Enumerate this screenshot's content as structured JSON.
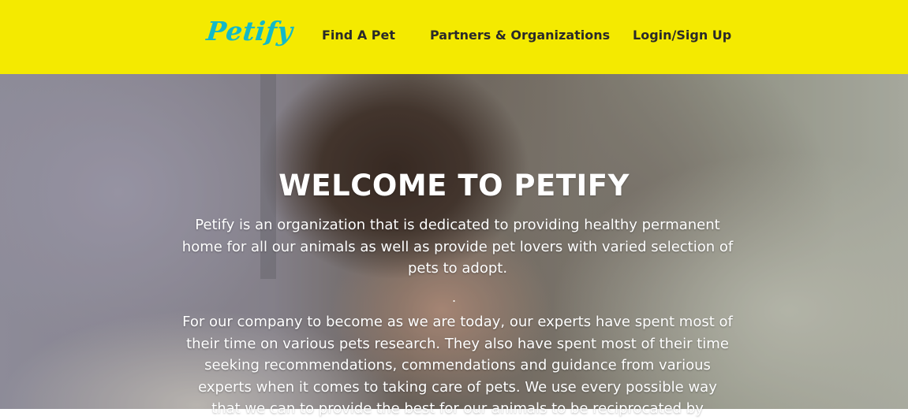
{
  "header": {
    "logo": "Petify",
    "nav": {
      "find_pet": "Find A Pet",
      "partners": "Partners & Organizations",
      "login": "Login/Sign Up"
    }
  },
  "hero": {
    "title": "WELCOME TO PETIFY",
    "paragraph1": "Petify is an organization that is dedicated to providing healthy permanent home for all our animals as well as provide pet lovers with varied selection of pets to adopt.",
    "separator": ".",
    "paragraph2": "For our company to become as we are today, our experts have spent most of their time on various pets research. They also have spent most of their time seeking recommendations, commendations and guidance from various experts when it comes to taking care of pets. We use every possible way that we can to provide the best for our animals to be reciprocated by"
  },
  "colors": {
    "header_background": "#f4ea00",
    "logo": "#12b9c8",
    "nav_text": "#2a2a2a",
    "hero_text": "#ffffff"
  }
}
